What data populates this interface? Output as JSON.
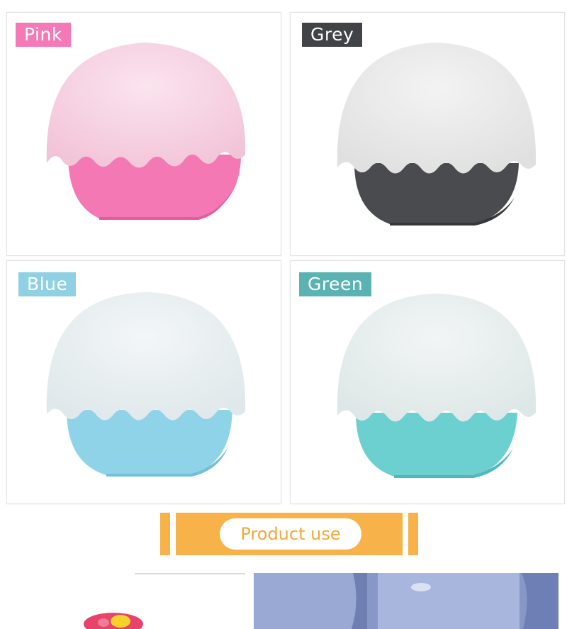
{
  "variants": [
    {
      "label": "Pink",
      "tag_color": "#f579b6",
      "cap_color": "#f6d3e2",
      "base_color": "#f478b3",
      "base_dark": "#e25d9c"
    },
    {
      "label": "Grey",
      "tag_color": "#414346",
      "cap_color": "#eaeaea",
      "base_color": "#4a4b4e",
      "base_dark": "#36373a"
    },
    {
      "label": "Blue",
      "tag_color": "#8fd0e4",
      "cap_color": "#eaeff1",
      "base_color": "#8fd3e8",
      "base_dark": "#74bfd8"
    },
    {
      "label": "Green",
      "tag_color": "#5bb2b2",
      "cap_color": "#e9eeee",
      "base_color": "#6ccfd0",
      "base_dark": "#52b8bb"
    }
  ],
  "section": {
    "title": "Product use",
    "banner_color": "#f7b24a",
    "title_color": "#f2a93b"
  }
}
